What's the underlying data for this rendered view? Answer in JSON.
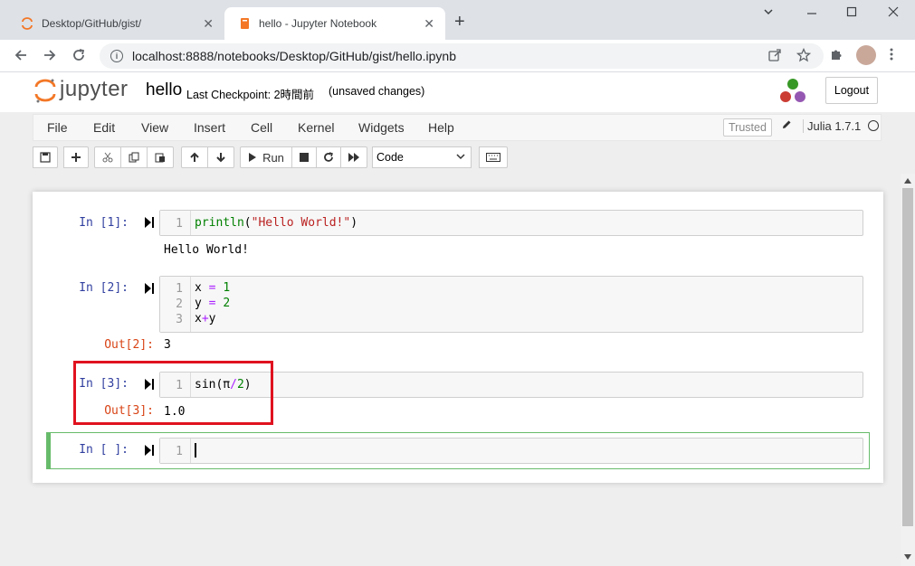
{
  "browser": {
    "tabs": [
      {
        "title": "Desktop/GitHub/gist/",
        "active": false
      },
      {
        "title": "hello - Jupyter Notebook",
        "active": true
      }
    ],
    "url": "localhost:8888/notebooks/Desktop/GitHub/gist/hello.ipynb",
    "close_glyph": "✕",
    "new_tab_glyph": "+"
  },
  "header": {
    "logo_text": "jupyter",
    "notebook_name": "hello",
    "checkpoint": "Last Checkpoint: 2時間前",
    "unsaved": "(unsaved changes)",
    "logout_label": "Logout"
  },
  "menubar": {
    "items": [
      "File",
      "Edit",
      "View",
      "Insert",
      "Cell",
      "Kernel",
      "Widgets",
      "Help"
    ],
    "trusted": "Trusted",
    "kernel": "Julia 1.7.1"
  },
  "toolbar": {
    "run_label": "Run",
    "cell_type": "Code"
  },
  "cells": [
    {
      "prompt": "In [1]:",
      "lines": [
        "println(\"Hello World!\")"
      ],
      "output_text": "Hello World!"
    },
    {
      "prompt": "In [2]:",
      "lines": [
        "x = 1",
        "y = 2",
        "x+y"
      ],
      "out_prompt": "Out[2]:",
      "output_text": "3"
    },
    {
      "prompt": "In [3]:",
      "lines": [
        "sin(π/2)"
      ],
      "out_prompt": "Out[3]:",
      "output_text": "1.0"
    },
    {
      "prompt": "In [ ]:",
      "lines": [
        ""
      ]
    }
  ],
  "line_numbers": [
    "1",
    "2",
    "3"
  ],
  "colors": {
    "prompt_in": "#303f9f",
    "prompt_out": "#d84315",
    "highlight": "#e0121f",
    "selected_cell": "#66bb6a"
  }
}
